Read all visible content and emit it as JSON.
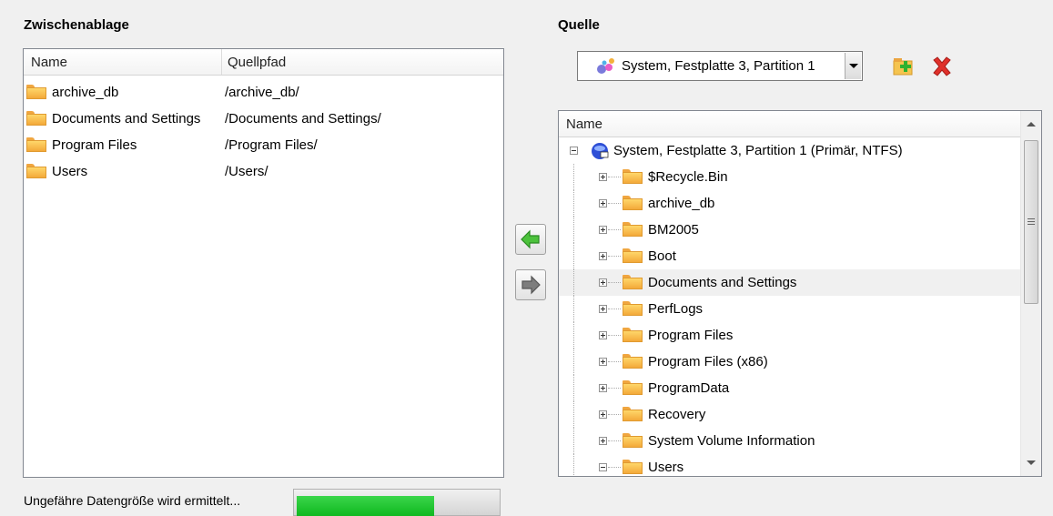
{
  "clipboard": {
    "title": "Zwischenablage",
    "columns": [
      "Name",
      "Quellpfad"
    ],
    "rows": [
      {
        "name": "archive_db",
        "path": "/archive_db/"
      },
      {
        "name": "Documents and Settings",
        "path": "/Documents and Settings/"
      },
      {
        "name": "Program Files",
        "path": "/Program Files/"
      },
      {
        "name": "Users",
        "path": "/Users/"
      }
    ]
  },
  "source": {
    "title": "Quelle",
    "selected_partition": "System, Festplatte 3, Partition 1",
    "tree_header": "Name",
    "root": "System, Festplatte 3, Partition 1 (Primär, NTFS)",
    "items": [
      {
        "label": "$Recycle.Bin",
        "expanded": false,
        "selected": false
      },
      {
        "label": "archive_db",
        "expanded": false,
        "selected": false
      },
      {
        "label": "BM2005",
        "expanded": false,
        "selected": false
      },
      {
        "label": "Boot",
        "expanded": false,
        "selected": false
      },
      {
        "label": "Documents and Settings",
        "expanded": false,
        "selected": true
      },
      {
        "label": "PerfLogs",
        "expanded": false,
        "selected": false
      },
      {
        "label": "Program Files",
        "expanded": false,
        "selected": false
      },
      {
        "label": "Program Files (x86)",
        "expanded": false,
        "selected": false
      },
      {
        "label": "ProgramData",
        "expanded": false,
        "selected": false
      },
      {
        "label": "Recovery",
        "expanded": false,
        "selected": false
      },
      {
        "label": "System Volume Information",
        "expanded": false,
        "selected": false
      },
      {
        "label": "Users",
        "expanded": true,
        "selected": false
      }
    ]
  },
  "status": {
    "text": "Ungefähre Datengröße wird ermittelt...",
    "progress_fraction": 0.68
  },
  "icons": {
    "add_to_clipboard": "add-folder-icon",
    "remove": "red-x-icon",
    "move_left": "green-left-arrow-icon",
    "move_right": "gray-right-arrow-icon"
  },
  "colors": {
    "progress_green": "#1fc42e",
    "selection_bg": "#f0f0f0",
    "remove_red": "#e0302a"
  }
}
